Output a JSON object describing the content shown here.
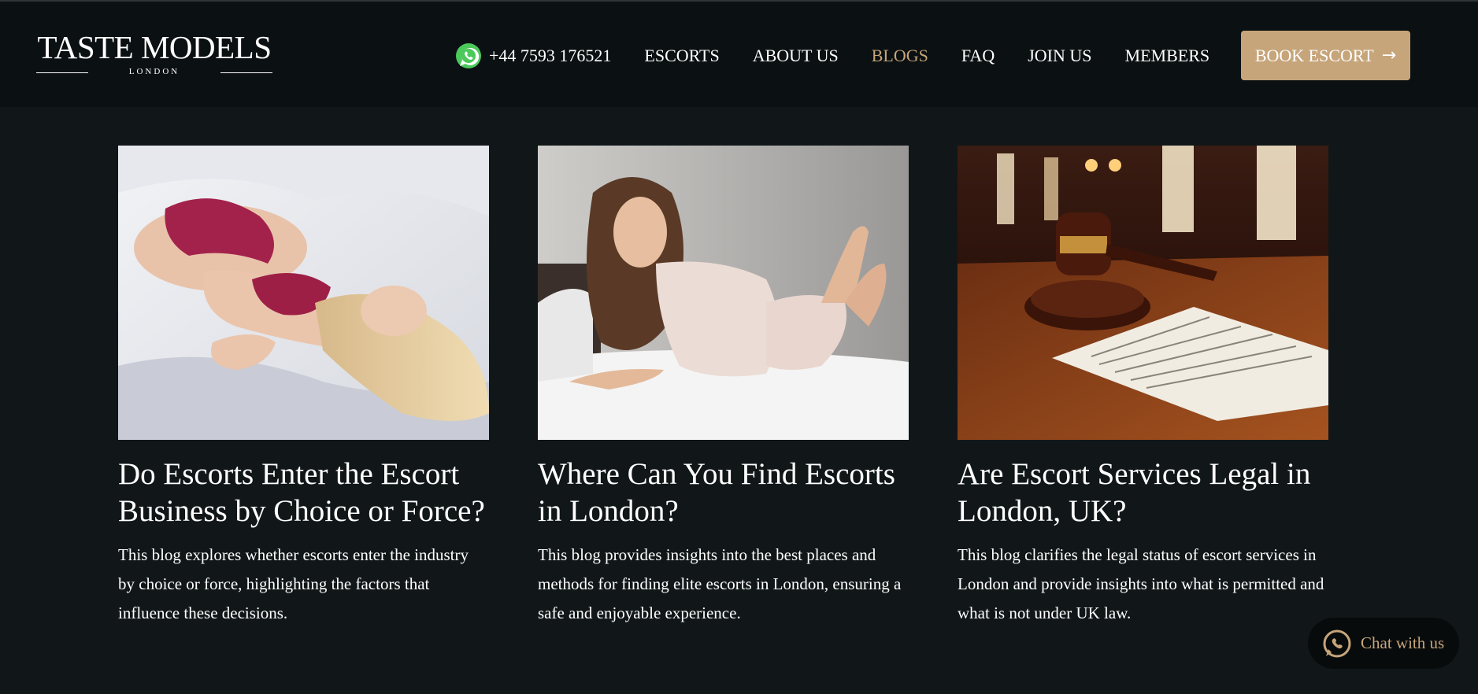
{
  "brand": {
    "name": "TASTE MODELS",
    "location": "LONDON"
  },
  "nav": {
    "phone": "+44 7593 176521",
    "items": [
      {
        "label": "ESCORTS",
        "active": false
      },
      {
        "label": "ABOUT US",
        "active": false
      },
      {
        "label": "BLOGS",
        "active": true
      },
      {
        "label": "FAQ",
        "active": false
      },
      {
        "label": "JOIN US",
        "active": false
      },
      {
        "label": "MEMBERS",
        "active": false
      }
    ],
    "cta": "BOOK ESCORT",
    "cta_icon": "arrow-right-icon"
  },
  "posts": [
    {
      "title": "Do Escorts Enter the Escort Business by Choice or Force?",
      "description": "This blog explores whether escorts enter the industry by choice or force, highlighting the factors that influence these decisions."
    },
    {
      "title": "Where Can You Find Escorts in London?",
      "description": "This blog provides insights into the best places and methods for finding elite escorts in London, ensuring a safe and enjoyable experience."
    },
    {
      "title": "Are Escort Services Legal in London, UK?",
      "description": "This blog clarifies the legal status of escort services in London and provide insights into what is permitted and what is not under UK law."
    }
  ],
  "chat": {
    "label": "Chat with us",
    "icon": "whatsapp-icon"
  },
  "colors": {
    "background": "#111719",
    "header": "#0b1012",
    "accent": "#c6a57a",
    "whatsapp": "#4bc95a"
  }
}
